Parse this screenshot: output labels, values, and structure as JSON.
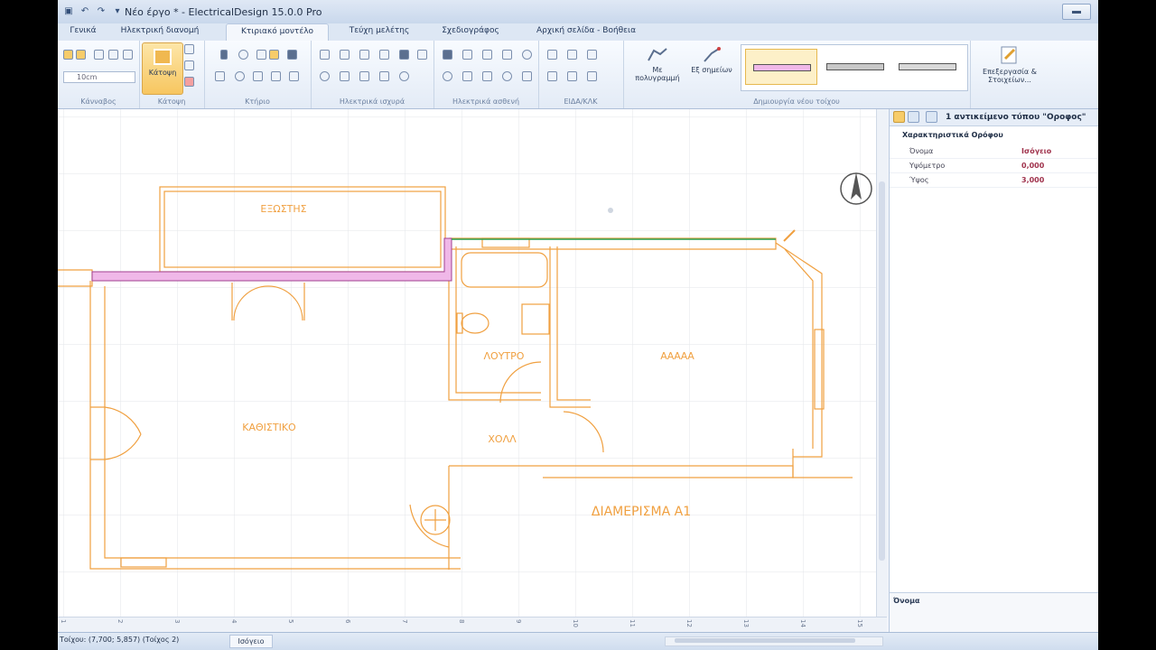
{
  "window": {
    "title": "Νέο έργο * - ElectricalDesign 15.0.0 Pro"
  },
  "ribbon_tabs": [
    {
      "label": "Γενικά"
    },
    {
      "label": "Ηλεκτρική διανομή"
    },
    {
      "label": "Κτιριακό μοντέλο",
      "active": true
    },
    {
      "label": "Τεύχη μελέτης"
    },
    {
      "label": "Σχεδιογράφος"
    },
    {
      "label": "Αρχική σελίδα - Βοήθεια"
    }
  ],
  "ribbon": {
    "groups": {
      "kannavos": "Κάνναβος",
      "katopsi": "Κάτοψη",
      "ktirio": "Κτήριο",
      "ilektrika_isxyra": "Ηλεκτρικά ισχυρά",
      "ilektrika_astheni": "Ηλεκτρικά ασθενή",
      "eida_klk": "ΕΙΔΑ/ΚΛΚ",
      "dimiourgia_toixou": "Δημιουργία νέου τοίχου"
    },
    "grid_step_value": "10cm",
    "katopsi_button": "Κάτοψη",
    "polygon_button": "Με πολυγραμμή",
    "points_button": "Εξ σημείων",
    "edit_button": "Επεξεργασία & Στοιχείων..."
  },
  "plan": {
    "rooms": {
      "exostis": "ΕΞΩΣΤΗΣ",
      "loutro": "ΛΟΥΤΡΟ",
      "aaaaa": "ΑΑΑΑΑ",
      "kathistiko": "ΚΑΘΙΣΤΙΚΟ",
      "xoll": "ΧΟΛΛ",
      "diamerisma": "ΔΙΑΜΕΡΙΣΜΑ Α1"
    },
    "ruler_ticks": [
      "1",
      "2",
      "3",
      "4",
      "5",
      "6",
      "7",
      "8",
      "9",
      "10",
      "11",
      "12",
      "13",
      "14",
      "15"
    ]
  },
  "properties": {
    "title": "1 αντικείμενο τύπου \"Οροφος\"",
    "category": "Χαρακτηριστικά Ορόφου",
    "rows": [
      {
        "name": "Όνομα",
        "value": "Ισόγειο"
      },
      {
        "name": "Υψόμετρο",
        "value": "0,000"
      },
      {
        "name": "Ύψος",
        "value": "3,000"
      }
    ],
    "description_label": "Όνομα"
  },
  "status": {
    "coords": "Τοίχου: (7,700; 5,857) (Τοίχος 2)",
    "floor": "Ισόγειο"
  },
  "colors": {
    "wall": "#f0a040",
    "selected_wall": "#f0b8e8",
    "accent": "#f7c660",
    "new_wall": "#2aa050"
  }
}
